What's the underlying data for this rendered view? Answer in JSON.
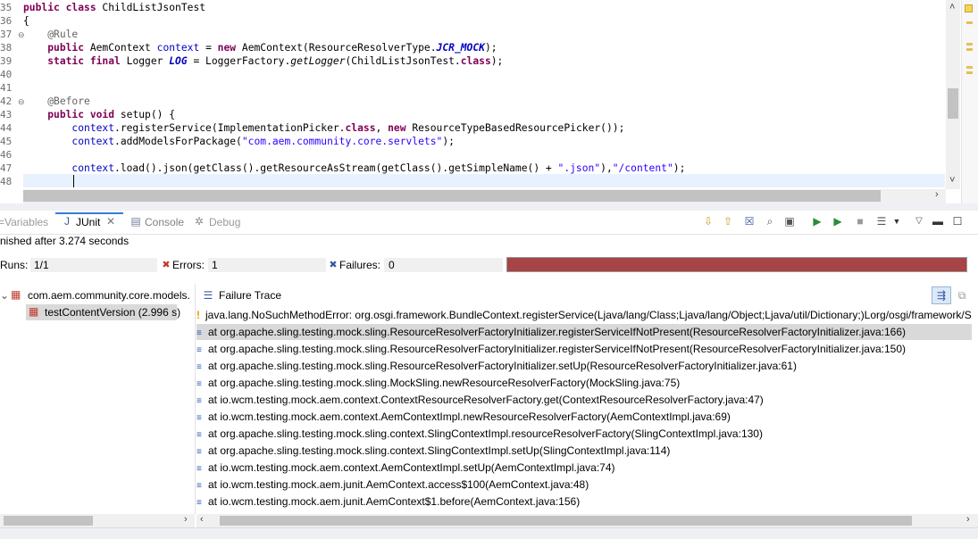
{
  "editor": {
    "line_numbers": [
      "35",
      "36",
      "37",
      "38",
      "39",
      "40",
      "41",
      "42",
      "43",
      "44",
      "45",
      "46",
      "47",
      "48"
    ],
    "lines": [
      {
        "parts": [
          [
            "kw",
            "public class "
          ],
          [
            "",
            "ChildListJsonTest"
          ]
        ]
      },
      {
        "parts": [
          [
            "",
            "{"
          ]
        ]
      },
      {
        "parts": [
          [
            "",
            "    "
          ],
          [
            "ann",
            "@Rule"
          ]
        ]
      },
      {
        "parts": [
          [
            "",
            "    "
          ],
          [
            "kw",
            "public "
          ],
          [
            "",
            "AemContext "
          ],
          [
            "fld",
            "context"
          ],
          [
            "",
            " = "
          ],
          [
            "kw",
            "new "
          ],
          [
            "",
            "AemContext(ResourceResolverType."
          ],
          [
            "ifld",
            "JCR_MOCK"
          ],
          [
            "",
            ");"
          ]
        ]
      },
      {
        "parts": [
          [
            "",
            "    "
          ],
          [
            "kw",
            "static final "
          ],
          [
            "",
            "Logger "
          ],
          [
            "ifld",
            "LOG"
          ],
          [
            "",
            " = LoggerFactory."
          ],
          [
            "it",
            "getLogger"
          ],
          [
            "",
            "(ChildListJsonTest."
          ],
          [
            "kw",
            "class"
          ],
          [
            "",
            ");"
          ]
        ]
      },
      {
        "parts": []
      },
      {
        "parts": []
      },
      {
        "parts": [
          [
            "",
            "    "
          ],
          [
            "ann",
            "@Before"
          ]
        ]
      },
      {
        "parts": [
          [
            "",
            "    "
          ],
          [
            "kw",
            "public void "
          ],
          [
            "",
            "setup() {"
          ]
        ]
      },
      {
        "parts": [
          [
            "",
            "        "
          ],
          [
            "fld",
            "context"
          ],
          [
            "",
            ".registerService(ImplementationPicker."
          ],
          [
            "kw",
            "class"
          ],
          [
            "",
            ", "
          ],
          [
            "kw",
            "new "
          ],
          [
            "",
            "ResourceTypeBasedResourcePicker());"
          ]
        ]
      },
      {
        "parts": [
          [
            "",
            "        "
          ],
          [
            "fld",
            "context"
          ],
          [
            "",
            ".addModelsForPackage("
          ],
          [
            "str",
            "\"com.aem.community.core.servlets\""
          ],
          [
            "",
            ");"
          ]
        ]
      },
      {
        "parts": []
      },
      {
        "parts": [
          [
            "",
            "        "
          ],
          [
            "fld",
            "context"
          ],
          [
            "",
            ".load().json(getClass().getResourceAsStream(getClass().getSimpleName() + "
          ],
          [
            "str",
            "\".json\""
          ],
          [
            "",
            "),"
          ],
          [
            "str",
            "\"/content\""
          ],
          [
            "",
            ");"
          ]
        ]
      },
      {
        "parts": []
      }
    ]
  },
  "tabs": {
    "variables": "Variables",
    "junit": "JUnit",
    "console": "Console",
    "debug": "Debug"
  },
  "status_text": "nished after 3.274 seconds",
  "counters": {
    "runs_label": "Runs:",
    "runs_value": "1/1",
    "errors_label": "Errors:",
    "errors_value": "1",
    "failures_label": "Failures:",
    "failures_value": "0"
  },
  "colors": {
    "progress_bar": "#a64446"
  },
  "tree": {
    "suite": "com.aem.community.core.models.",
    "test": "testContentVersion (2.996 s)"
  },
  "trace": {
    "title": "Failure Trace",
    "exception": "java.lang.NoSuchMethodError: org.osgi.framework.BundleContext.registerService(Ljava/lang/Class;Ljava/lang/Object;Ljava/util/Dictionary;)Lorg/osgi/framework/S",
    "frames": [
      "at org.apache.sling.testing.mock.sling.ResourceResolverFactoryInitializer.registerServiceIfNotPresent(ResourceResolverFactoryInitializer.java:166)",
      "at org.apache.sling.testing.mock.sling.ResourceResolverFactoryInitializer.registerServiceIfNotPresent(ResourceResolverFactoryInitializer.java:150)",
      "at org.apache.sling.testing.mock.sling.ResourceResolverFactoryInitializer.setUp(ResourceResolverFactoryInitializer.java:61)",
      "at org.apache.sling.testing.mock.sling.MockSling.newResourceResolverFactory(MockSling.java:75)",
      "at io.wcm.testing.mock.aem.context.ContextResourceResolverFactory.get(ContextResourceResolverFactory.java:47)",
      "at io.wcm.testing.mock.aem.context.AemContextImpl.newResourceResolverFactory(AemContextImpl.java:69)",
      "at org.apache.sling.testing.mock.sling.context.SlingContextImpl.resourceResolverFactory(SlingContextImpl.java:130)",
      "at org.apache.sling.testing.mock.sling.context.SlingContextImpl.setUp(SlingContextImpl.java:114)",
      "at io.wcm.testing.mock.aem.context.AemContextImpl.setUp(AemContextImpl.java:74)",
      "at io.wcm.testing.mock.aem.junit.AemContext.access$100(AemContext.java:48)",
      "at io.wcm.testing.mock.aem.junit.AemContext$1.before(AemContext.java:156)"
    ]
  }
}
